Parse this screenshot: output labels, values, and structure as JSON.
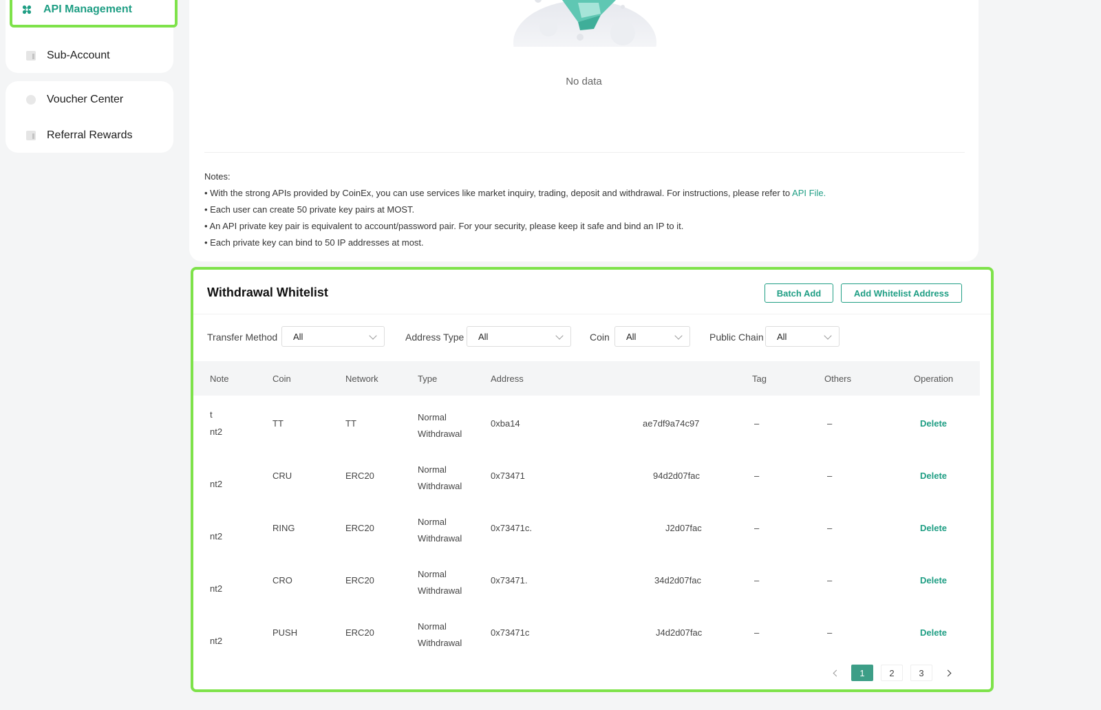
{
  "sidebar": {
    "items": [
      {
        "label": "API Management",
        "icon": "api-icon",
        "active": true
      },
      {
        "label": "Sub-Account",
        "icon": "sub-account-icon"
      },
      {
        "label": "Voucher Center",
        "icon": "voucher-icon"
      },
      {
        "label": "Referral Rewards",
        "icon": "referral-icon"
      }
    ]
  },
  "api": {
    "empty_text": "No data",
    "notes_title": "Notes:",
    "notes": [
      "• With the strong APIs provided by CoinEx, you can use services like market inquiry, trading, deposit and withdrawal. For instructions, please refer to ",
      "• Each user can create 50 private key pairs at MOST.",
      "• An API private key pair is equivalent to account/password pair. For your security, please keep it safe and bind an IP to it.",
      "• Each private key can bind to 50 IP addresses at most."
    ],
    "api_file_link": "API File",
    "note1_suffix": "."
  },
  "whitelist": {
    "title": "Withdrawal Whitelist",
    "batch_add_label": "Batch Add",
    "add_address_label": "Add Whitelist Address",
    "filters": [
      {
        "label": "Transfer Method",
        "value": "All"
      },
      {
        "label": "Address Type",
        "value": "All"
      },
      {
        "label": "Coin",
        "value": "All"
      },
      {
        "label": "Public Chain",
        "value": "All"
      }
    ],
    "columns": [
      "Note",
      "Coin",
      "Network",
      "Type",
      "Address",
      "Tag",
      "Others",
      "Operation"
    ],
    "rows": [
      {
        "note1": "t",
        "note2": "nt2",
        "coin": "TT",
        "network": "TT",
        "type1": "Normal",
        "type2": "Withdrawal",
        "addr_start": "0xba14",
        "addr_end": "ae7df9a74c97",
        "tag": "–",
        "others": "–",
        "op": "Delete"
      },
      {
        "note1": "",
        "note2": "nt2",
        "coin": "CRU",
        "network": "ERC20",
        "type1": "Normal",
        "type2": "Withdrawal",
        "addr_start": "0x73471",
        "addr_end": "94d2d07fac",
        "tag": "–",
        "others": "–",
        "op": "Delete"
      },
      {
        "note1": "",
        "note2": "nt2",
        "coin": "RING",
        "network": "ERC20",
        "type1": "Normal",
        "type2": "Withdrawal",
        "addr_start": "0x73471c.",
        "addr_end": "J2d07fac",
        "tag": "–",
        "others": "–",
        "op": "Delete"
      },
      {
        "note1": "",
        "note2": "nt2",
        "coin": "CRO",
        "network": "ERC20",
        "type1": "Normal",
        "type2": "Withdrawal",
        "addr_start": "0x73471.",
        "addr_end": "34d2d07fac",
        "tag": "–",
        "others": "–",
        "op": "Delete"
      },
      {
        "note1": "",
        "note2": "nt2",
        "coin": "PUSH",
        "network": "ERC20",
        "type1": "Normal",
        "type2": "Withdrawal",
        "addr_start": "0x73471c",
        "addr_end": "J4d2d07fac",
        "tag": "–",
        "others": "–",
        "op": "Delete"
      }
    ],
    "pagination": {
      "pages": [
        "1",
        "2",
        "3"
      ],
      "current": "1"
    }
  },
  "colors": {
    "accent": "#1f9e84",
    "highlight": "#7ee24a",
    "page_bg": "#f4f5f6"
  }
}
